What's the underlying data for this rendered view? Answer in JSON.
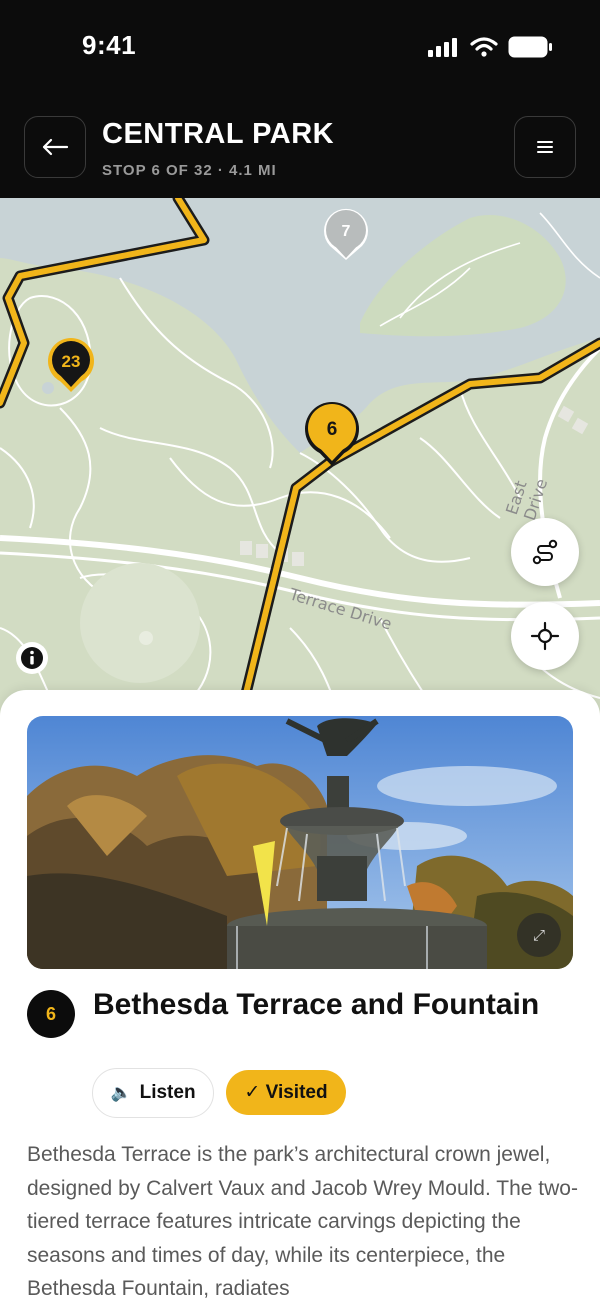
{
  "status_bar": {
    "time": "9:41"
  },
  "header": {
    "title": "CENTRAL PARK",
    "subtitle": "STOP 6 OF 32 · 4.1 MI",
    "back_icon": "arrow-left-icon",
    "menu_icon": "menu-icon"
  },
  "map": {
    "markers": [
      {
        "label": "7",
        "state": "upcoming"
      },
      {
        "label": "23",
        "state": "route"
      },
      {
        "label": "6",
        "state": "current"
      }
    ],
    "street_labels": {
      "terrace": "Terrace Drive",
      "east": "East Drive"
    },
    "buttons": {
      "route": "route-icon",
      "locate": "locate-icon",
      "info": "info-icon"
    },
    "colors": {
      "route": "#f1b51a",
      "water": "#c8d3d6",
      "park": "#d2dcc3",
      "paths": "#ffffff"
    }
  },
  "stop": {
    "number": "6",
    "title": "Bethesda Terrace and Fountain",
    "listen_label": "Listen",
    "listen_icon": "🔈",
    "visited_label": "✓ Visited",
    "expand_icon": "⤢",
    "description": "Bethesda Terrace is the park’s architectural crown jewel, designed by Calvert Vaux and Jacob Wrey Mould. The two-tiered terrace features intricate carvings depicting the seasons and times of day, while its centerpiece, the Bethesda Fountain, radiates"
  }
}
